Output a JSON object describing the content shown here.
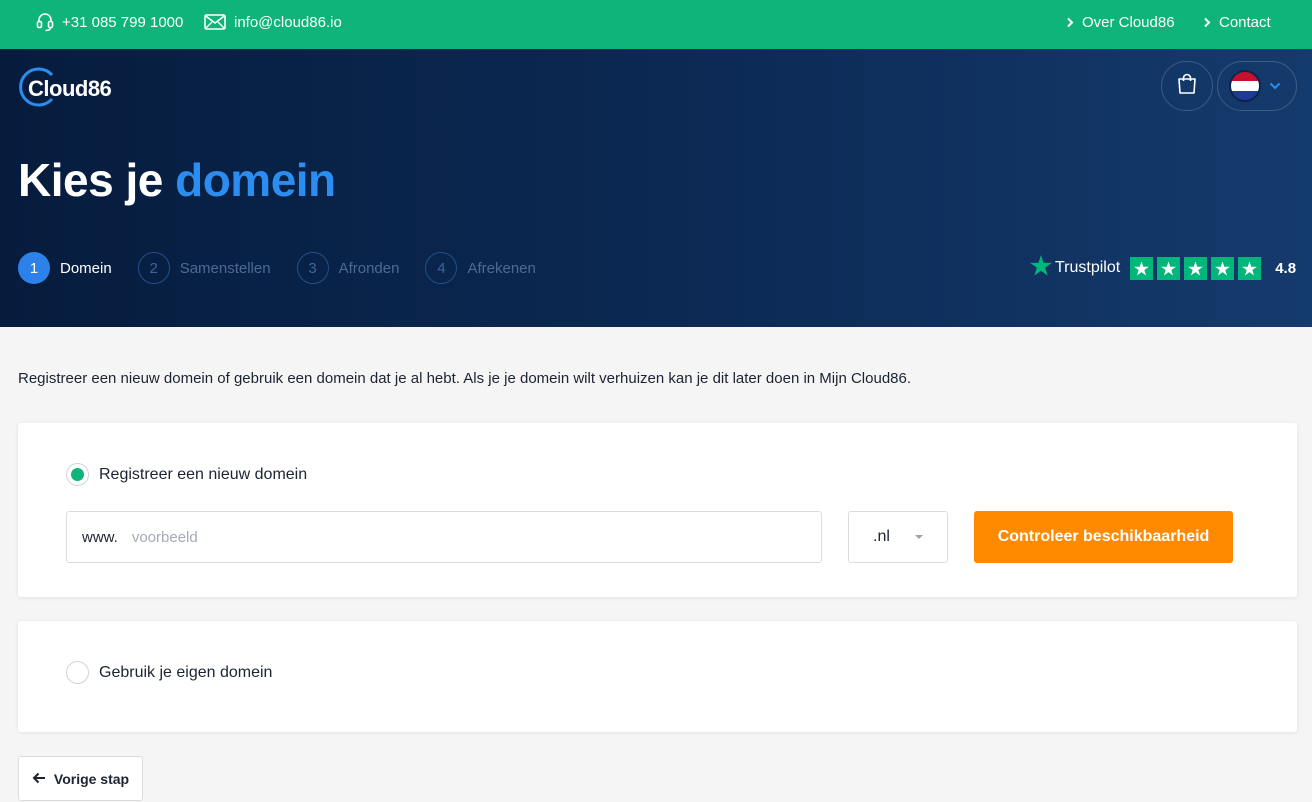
{
  "topbar": {
    "phone": "+31 085 799 1000",
    "email": "info@cloud86.io",
    "links": [
      "Over Cloud86",
      "Contact"
    ]
  },
  "header": {
    "logo_text": "Cloud86",
    "cart_icon": "shopping-bag-icon",
    "language": {
      "selected_flag": "netherlands-flag",
      "chevron": "chevron-down-icon"
    }
  },
  "hero": {
    "title_prefix": "Kies je",
    "title_accent": "domein",
    "steps": [
      {
        "number": "1",
        "label": "Domein",
        "active": true
      },
      {
        "number": "2",
        "label": "Samenstellen",
        "active": false
      },
      {
        "number": "3",
        "label": "Afronden",
        "active": false
      },
      {
        "number": "4",
        "label": "Afrekenen",
        "active": false
      }
    ],
    "trustpilot": {
      "brand": "Trustpilot",
      "stars": 5,
      "score": "4.8"
    }
  },
  "main": {
    "intro": "Registreer een nieuw domein of gebruik een domein dat je al hebt. Als je je domein wilt verhuizen kan je dit later doen in Mijn Cloud86.",
    "option_new": {
      "label": "Registreer een nieuw domein",
      "selected": true,
      "prefix": "www.",
      "input_value": "",
      "placeholder": "voorbeeld",
      "tld": ".nl",
      "button": "Controleer beschikbaarheid"
    },
    "option_own": {
      "label": "Gebruik je eigen domein",
      "selected": false
    },
    "back_button": "Vorige stap"
  },
  "colors": {
    "topbar": "#0eb479",
    "hero_dark": "#061c3d",
    "accent_blue": "#2c8df0",
    "cta_orange": "#ff8a00",
    "trustpilot_green": "#00b67a"
  }
}
